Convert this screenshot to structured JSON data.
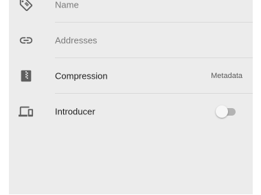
{
  "rows": {
    "name": {
      "label": "Name",
      "icon": "tag-icon",
      "placeholder": true
    },
    "addresses": {
      "label": "Addresses",
      "icon": "link-icon",
      "placeholder": true
    },
    "compression": {
      "label": "Compression",
      "icon": "zip-file-icon",
      "value": "Metadata"
    },
    "introducer": {
      "label": "Introducer",
      "icon": "devices-icon",
      "toggle_on": false
    }
  },
  "colors": {
    "panel_bg": "#ececec",
    "divider": "#d9d9d9",
    "icon": "#5f5f5f",
    "text_primary": "#202020",
    "text_hint": "#7a7a7a"
  }
}
